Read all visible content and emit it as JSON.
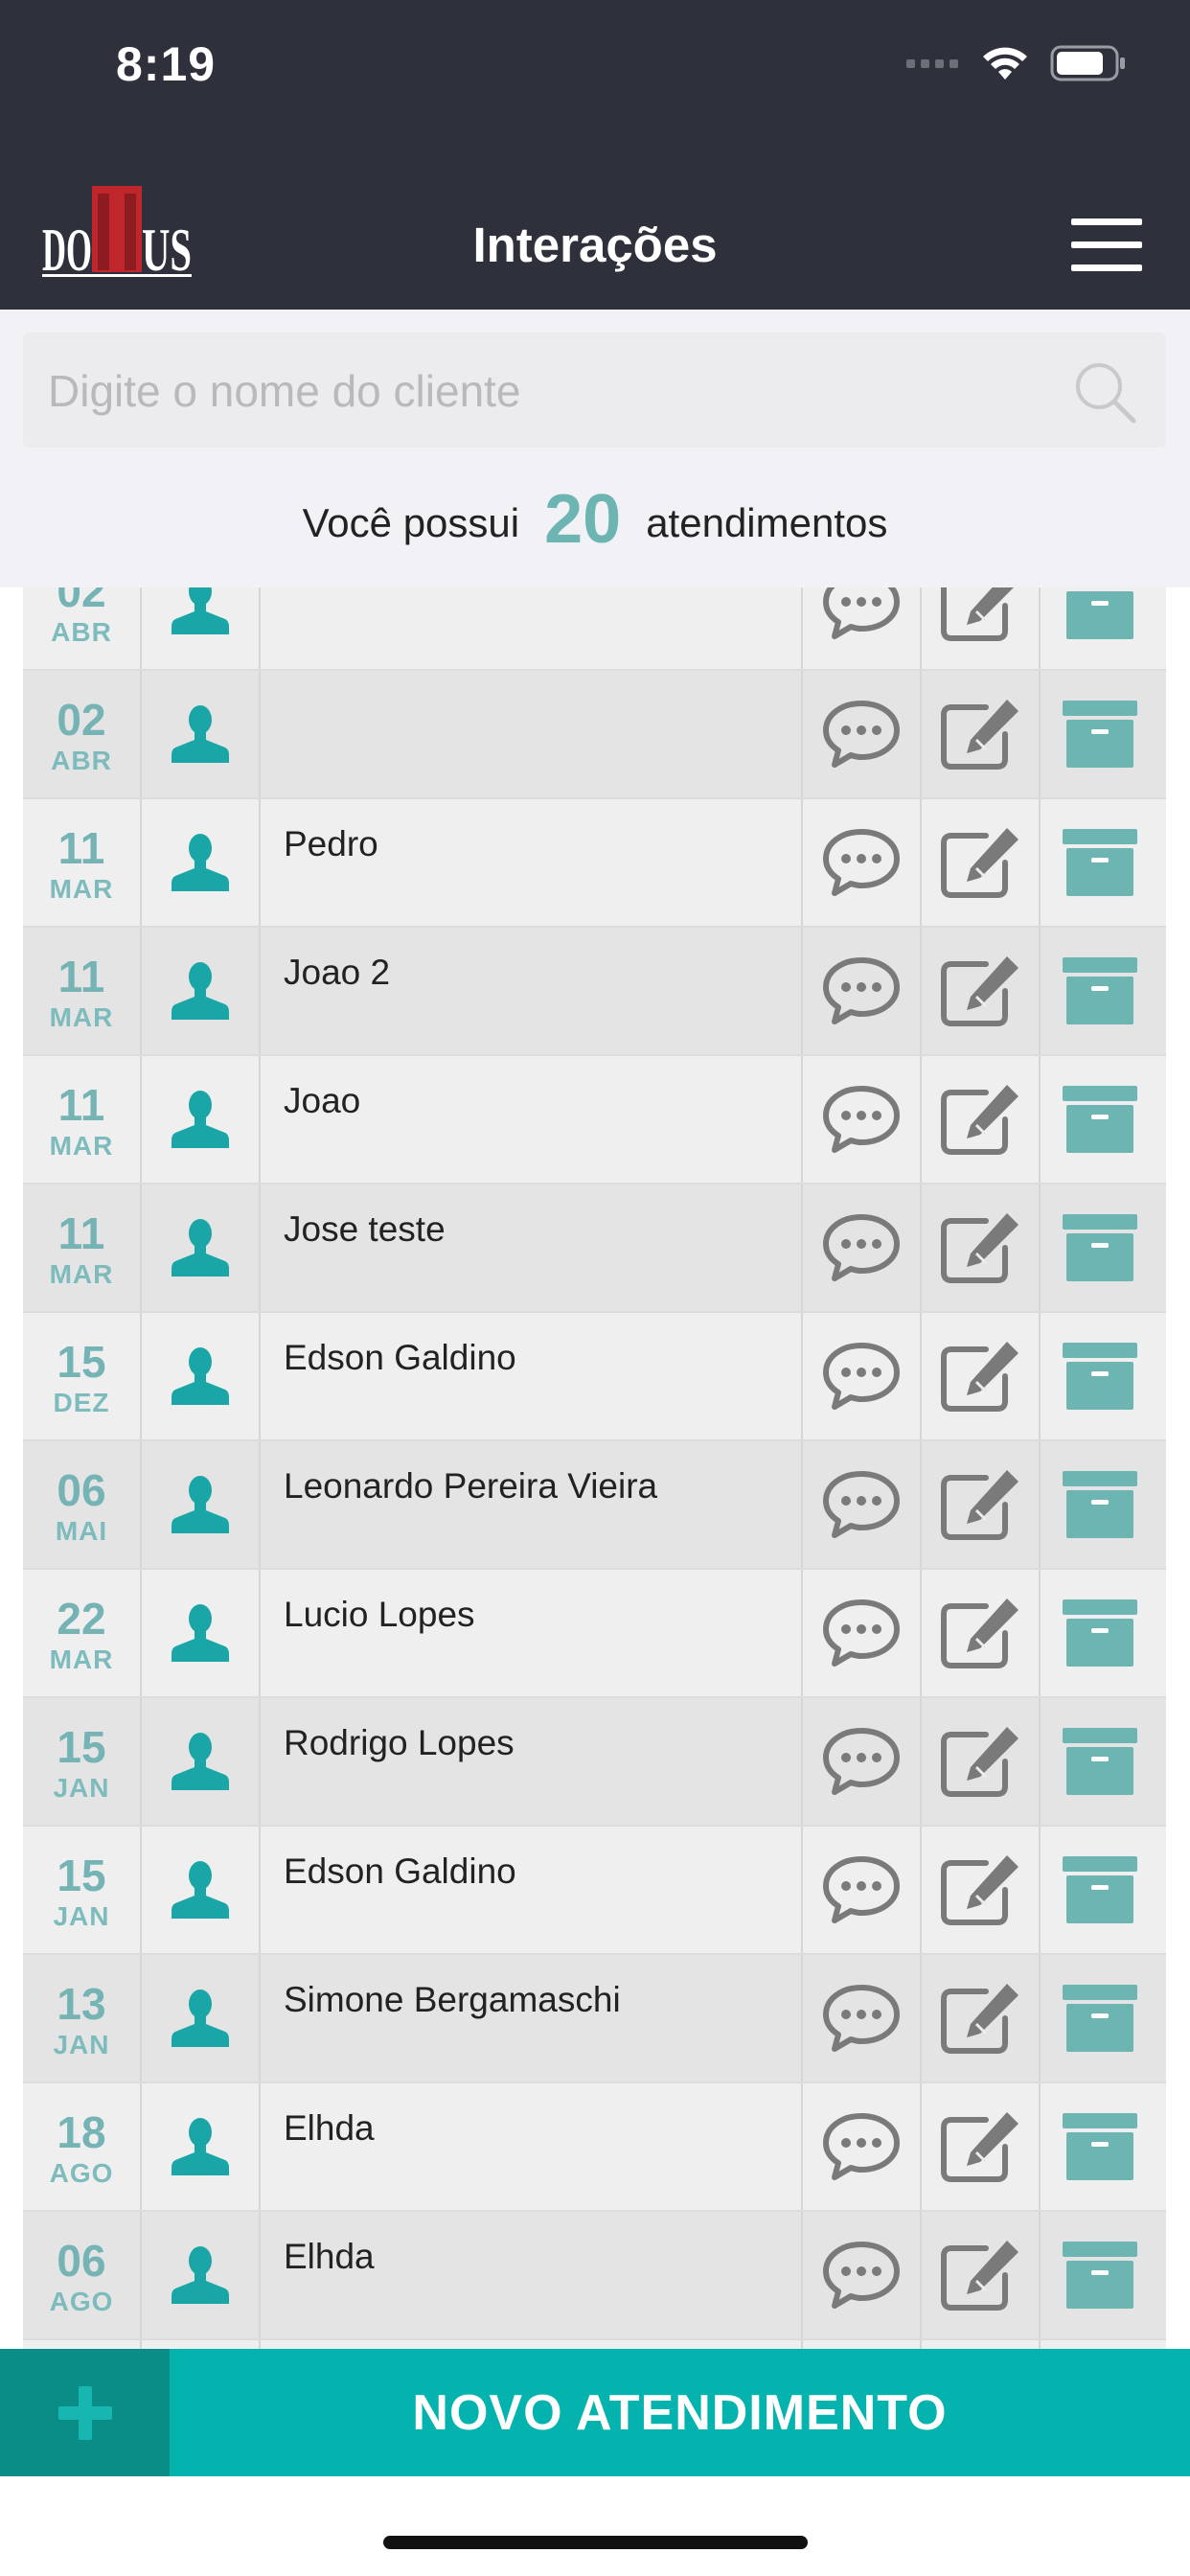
{
  "status_bar": {
    "time": "8:19"
  },
  "header": {
    "logo_text": "DOMUS",
    "title": "Interações"
  },
  "search": {
    "placeholder": "Digite o nome do cliente",
    "value": ""
  },
  "summary": {
    "prefix": "Você possui",
    "count": "20",
    "suffix": "atendimentos"
  },
  "rows": [
    {
      "day": "02",
      "month": "ABR",
      "name": ""
    },
    {
      "day": "02",
      "month": "ABR",
      "name": ""
    },
    {
      "day": "11",
      "month": "MAR",
      "name": "Pedro"
    },
    {
      "day": "11",
      "month": "MAR",
      "name": "Joao 2"
    },
    {
      "day": "11",
      "month": "MAR",
      "name": "Joao"
    },
    {
      "day": "11",
      "month": "MAR",
      "name": "Jose teste"
    },
    {
      "day": "15",
      "month": "DEZ",
      "name": "Edson Galdino"
    },
    {
      "day": "06",
      "month": "MAI",
      "name": "Leonardo Pereira Vieira"
    },
    {
      "day": "22",
      "month": "MAR",
      "name": "Lucio Lopes"
    },
    {
      "day": "15",
      "month": "JAN",
      "name": "Rodrigo Lopes"
    },
    {
      "day": "15",
      "month": "JAN",
      "name": "Edson Galdino"
    },
    {
      "day": "13",
      "month": "JAN",
      "name": "Simone Bergamaschi"
    },
    {
      "day": "18",
      "month": "AGO",
      "name": "Elhda"
    },
    {
      "day": "06",
      "month": "AGO",
      "name": "Elhda"
    },
    {
      "day": "",
      "month": "",
      "name": ""
    }
  ],
  "row_icons": {
    "avatar": "user-icon",
    "chat": "chat-bubble-icon",
    "edit": "edit-icon",
    "archive": "archive-box-icon"
  },
  "bottom_bar": {
    "add_icon": "plus-icon",
    "new_label": "NOVO ATENDIMENTO"
  },
  "colors": {
    "header_bg": "#2e303c",
    "accent_teal": "#05b3ae",
    "date_teal": "#76b3b5",
    "avatar_teal": "#1aa6a6",
    "archive_teal": "#6cb5b3",
    "icon_gray": "#7a7a7a"
  }
}
